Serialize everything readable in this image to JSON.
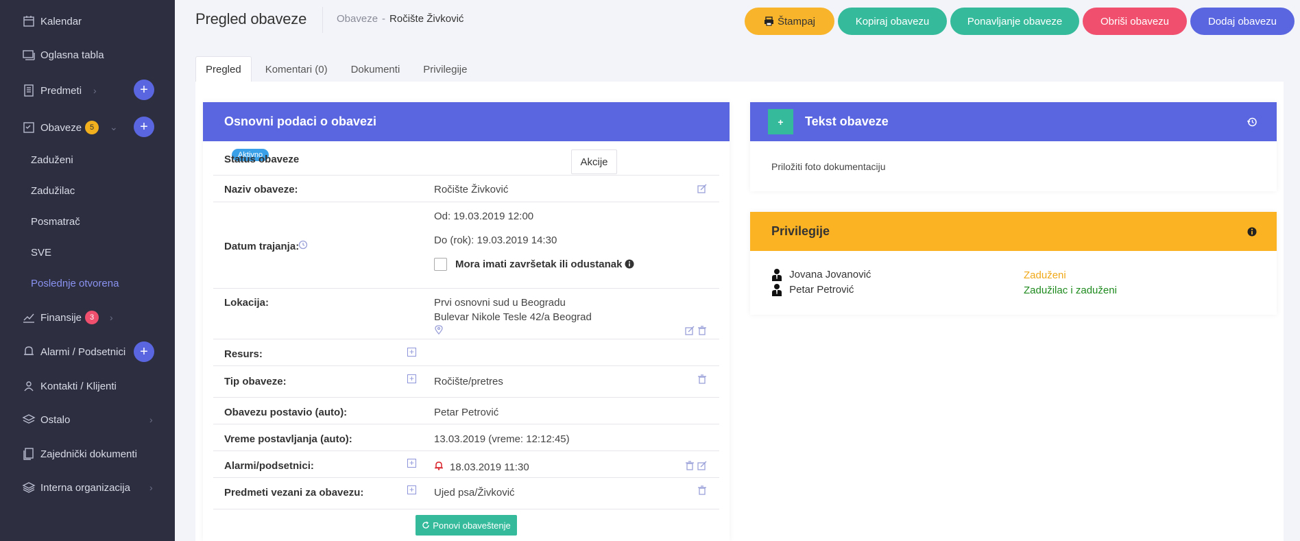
{
  "sidebar": {
    "items": [
      {
        "label": "Kalendar",
        "icon": "calendar-icon"
      },
      {
        "label": "Oglasna tabla",
        "icon": "board-icon"
      },
      {
        "label": "Predmeti",
        "icon": "document-icon"
      },
      {
        "label": "Obaveze",
        "icon": "tasks-icon",
        "badge": "5"
      },
      {
        "label": "Finansije",
        "icon": "chart-icon",
        "badge": "3"
      },
      {
        "label": "Alarmi / Podsetnici",
        "icon": "bell-icon"
      },
      {
        "label": "Kontakti / Klijenti",
        "icon": "contacts-icon"
      },
      {
        "label": "Ostalo",
        "icon": "layers-icon"
      },
      {
        "label": "Zajednički dokumenti",
        "icon": "shared-docs-icon"
      },
      {
        "label": "Interna organizacija",
        "icon": "org-icon"
      }
    ],
    "subitems": [
      "Zaduženi",
      "Zadužilac",
      "Posmatrač",
      "SVE",
      "Poslednje otvorena"
    ]
  },
  "header": {
    "title": "Pregled obaveze",
    "breadcrumb_parent": "Obaveze",
    "breadcrumb_sep": "-",
    "breadcrumb_current": "Ročište Živković",
    "buttons": {
      "print": "Štampaj",
      "copy": "Kopiraj obavezu",
      "repeat": "Ponavljanje obaveze",
      "delete": "Obriši obavezu",
      "add": "Dodaj obavezu"
    }
  },
  "tabs": [
    "Pregled",
    "Komentari (0)",
    "Dokumenti",
    "Privilegije"
  ],
  "basic": {
    "header": "Osnovni podaci o obavezi",
    "status_label": "Status obaveze",
    "status_value": "Aktivno",
    "actions_label": "Akcije",
    "name_label": "Naziv obaveze:",
    "name_value": "Ročište Živković",
    "duration_label": "Datum trajanja:",
    "from": "Od: 19.03.2019 12:00",
    "to": "Do (rok): 19.03.2019 14:30",
    "must_complete": "Mora imati završetak ili odustanak",
    "location_label": "Lokacija:",
    "location_name": "Prvi osnovni sud u Beogradu",
    "location_address": "Bulevar Nikole Tesle 42/a Beograd",
    "resource_label": "Resurs:",
    "type_label": "Tip obaveze:",
    "type_value": "Ročište/pretres",
    "created_by_label": "Obavezu postavio (auto):",
    "created_by_value": "Petar Petrović",
    "created_time_label": "Vreme postavljanja (auto):",
    "created_time_value": "13.03.2019 (vreme: 12:12:45)",
    "alarms_label": "Alarmi/podsetnici:",
    "alarms_value": "18.03.2019 11:30",
    "cases_label": "Predmeti vezani za obavezu:",
    "cases_value": "Ujed psa/Živković",
    "resend": "Ponovi obaveštenje"
  },
  "text_card": {
    "plus": "+",
    "header": "Tekst obaveze",
    "body": "Priložiti foto dokumentaciju"
  },
  "privileges": {
    "header": "Privilegije",
    "rows": [
      {
        "name": "Jovana Jovanović",
        "role": "Zaduženi",
        "color": "#f0a818"
      },
      {
        "name": "Petar Petrović",
        "role": "Zadužilac i zaduženi",
        "color": "#1e8a1e"
      }
    ]
  },
  "colors": {
    "sidebar_bg": "#2d2f41",
    "primary": "#5a66e0",
    "green": "#35bb9b",
    "red": "#f0506e",
    "yellow": "#f8b42b"
  }
}
